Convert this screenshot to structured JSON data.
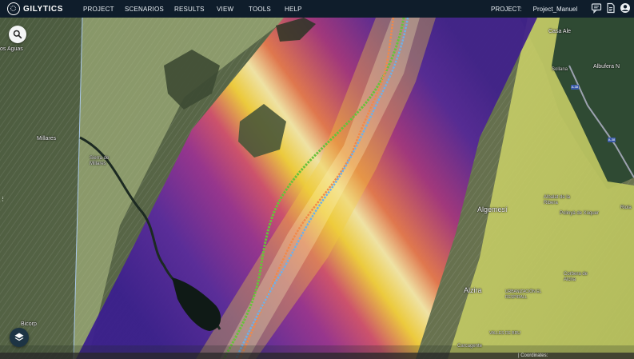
{
  "app": {
    "brand": "GILYTICS"
  },
  "nav": {
    "menu": [
      "PROJECT",
      "SCENARIOS",
      "RESULTS",
      "VIEW",
      "TOOLS",
      "HELP"
    ],
    "project_label": "PROJECT:",
    "project_name": "Project_Manuel",
    "icons": [
      "chat-icon",
      "document-icon",
      "user-account-icon"
    ]
  },
  "map": {
    "labels": [
      {
        "id": "los-aguas",
        "text": "os Aguas"
      },
      {
        "id": "casa-ale",
        "text": "Casa Ale"
      },
      {
        "id": "albufera",
        "text": "Albufera N"
      },
      {
        "id": "sollana",
        "text": "Sollana"
      },
      {
        "id": "millares",
        "text": "Millares"
      },
      {
        "id": "sierra-millares",
        "text": "Sierra de Millares"
      },
      {
        "id": "algemesi",
        "text": "Algemesí"
      },
      {
        "id": "albalat",
        "text": "Albalat de la Ribera"
      },
      {
        "id": "polinya",
        "text": "Polinyà de Xúquer"
      },
      {
        "id": "riola",
        "text": "Riola"
      },
      {
        "id": "alzira",
        "text": "Alzira"
      },
      {
        "id": "urbanizacion",
        "text": "URBANIZACIÓN EL RESPIRALL"
      },
      {
        "id": "corbera",
        "text": "Corbera de Alcira"
      },
      {
        "id": "bicorp",
        "text": "Bicorp"
      },
      {
        "id": "valles",
        "text": "VALLES DE BRU"
      },
      {
        "id": "carcagente",
        "text": "Carcagente"
      }
    ],
    "road_badges": [
      "A-38",
      "A-38"
    ],
    "icons": {
      "search": "search-icon",
      "layers": "layers-icon"
    },
    "colors": {
      "corridor_outer": "#8ea6b0",
      "cost_low": "#3b1f8e",
      "cost_mid": "#b8327a",
      "cost_high": "#f3cf3c",
      "route_green": "#67c23a",
      "route_orange": "#f0894a",
      "route_blue": "#6fb0e8"
    }
  },
  "status_bar": {
    "coordinates_label": "| Coordinates:"
  }
}
